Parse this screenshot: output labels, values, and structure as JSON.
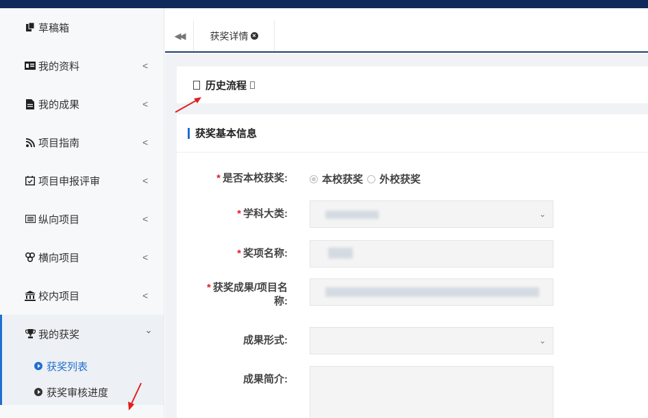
{
  "sidebar": {
    "drafts": "草稿箱",
    "my_profile": "我的资料",
    "my_results": "我的成果",
    "project_guide": "项目指南",
    "project_review": "项目申报评审",
    "vertical_projects": "纵向项目",
    "horizontal_projects": "横向项目",
    "campus_projects": "校内项目",
    "my_awards": "我的获奖",
    "award_list": "获奖列表",
    "award_review_progress": "获奖审核进度",
    "collapsed_caret": "<",
    "expanded_caret": "⌄"
  },
  "tabs": {
    "back": "◀◀",
    "active_tab": "获奖详情",
    "close": "×"
  },
  "history": {
    "label": "历史流程"
  },
  "section": {
    "title": "获奖基本信息"
  },
  "form": {
    "required_mark": "*",
    "is_school_award_label": "是否本校获奖:",
    "option_school": "本校获奖",
    "option_other": "外校获奖",
    "discipline_label": "学科大类:",
    "award_name_label": "奖项名称:",
    "project_name_label_line1": "获奖成果/项目名",
    "project_name_label_line2": "称:",
    "result_form_label": "成果形式:",
    "summary_label": "成果简介:",
    "select_chevron": "⌄"
  },
  "colors": {
    "accent": "#1f6fd0",
    "topbar": "#0f2a5a",
    "arrow": "#e02020",
    "required": "#e02020"
  }
}
